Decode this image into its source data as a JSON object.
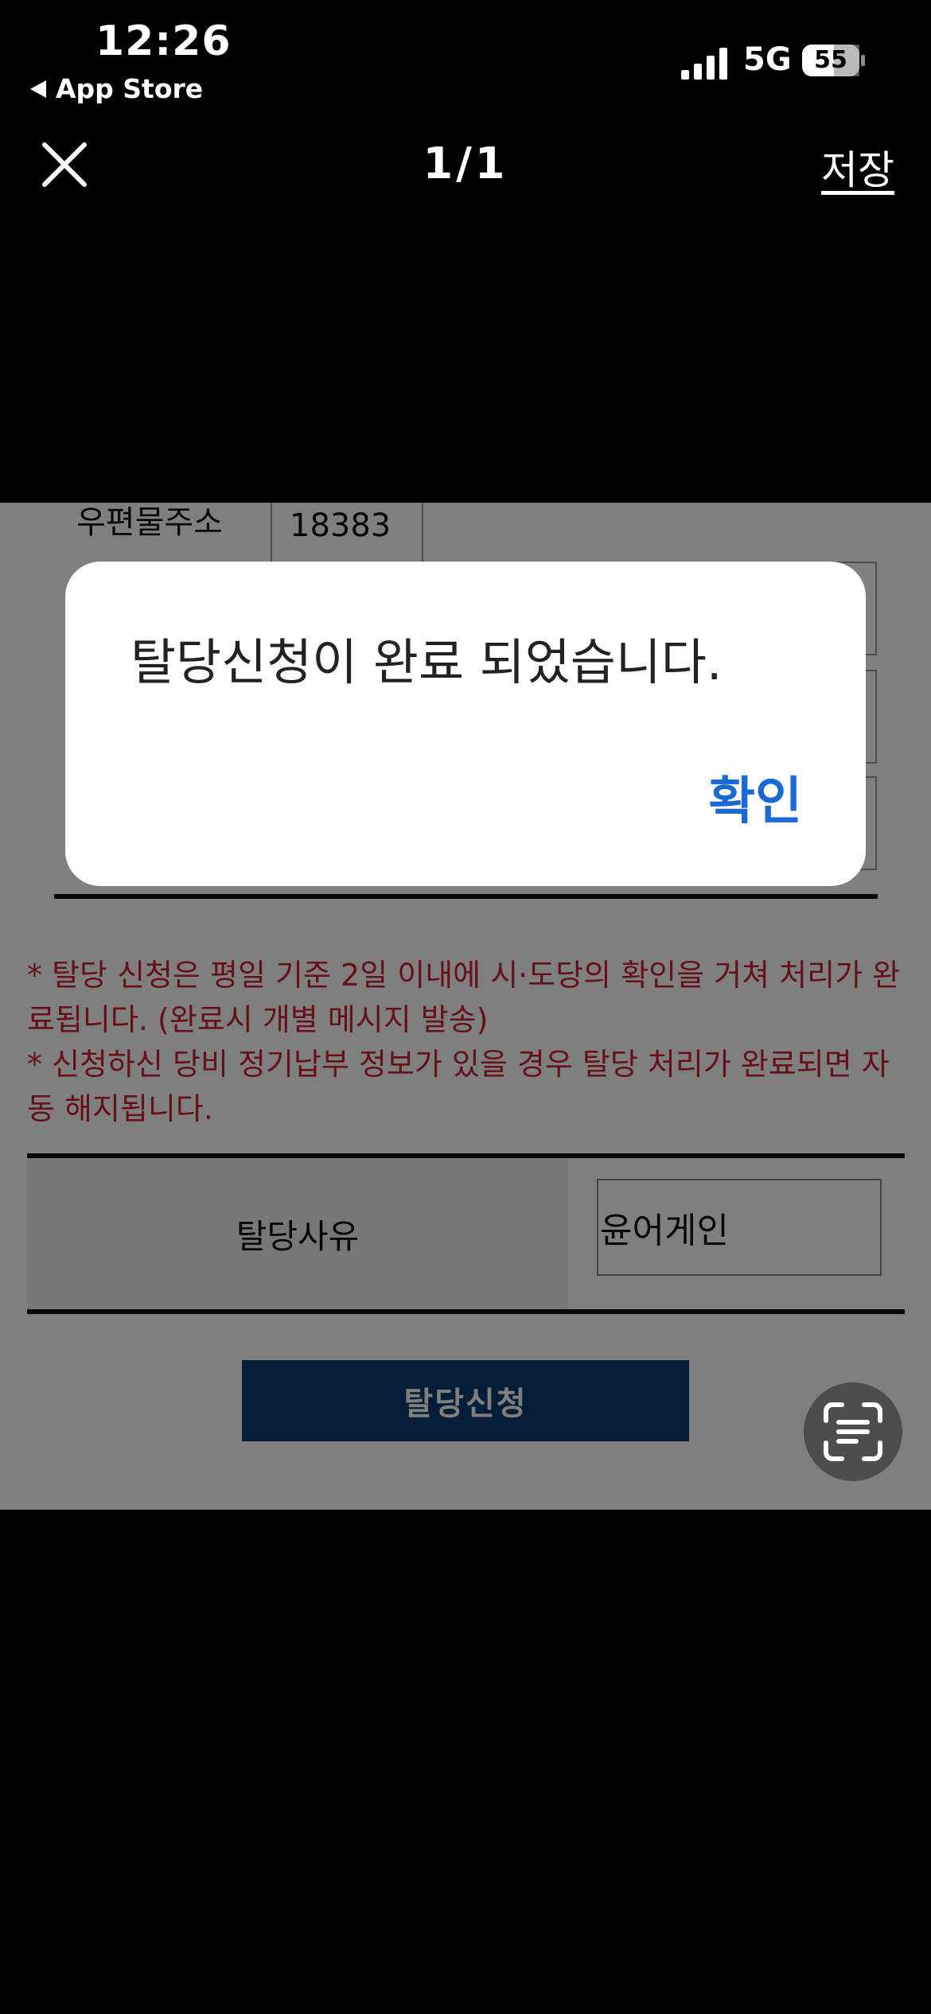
{
  "status_bar": {
    "time": "12:26",
    "back_app": "App Store",
    "network": "5G",
    "battery": "55"
  },
  "viewer": {
    "counter": "1/1",
    "save_label": "저장"
  },
  "form": {
    "postal_label": "우편물주소",
    "postal_value": "18383",
    "notes": [
      "* 탈당 신청은 평일 기준 2일 이내에 시·도당의 확인을 거쳐 처리가 완료됩니다. (완료시 개별 메시지 발송)",
      "* 신청하신 당비 정기납부 정보가 있을 경우 탈당 처리가 완료되면 자동 해지됩니다."
    ],
    "reason_label": "탈당사유",
    "reason_value": "윤어게인",
    "submit_label": "탈당신청"
  },
  "dialog": {
    "message": "탈당신청이 완료 되었습니다.",
    "confirm_label": "확인"
  },
  "colors": {
    "accent_blue": "#1a6ad6",
    "notice_red": "#cc2233",
    "submit_navy": "#0b3a6e"
  },
  "icons": [
    "signal-icon",
    "battery-icon",
    "close-icon",
    "live-text-scan-icon",
    "back-triangle-icon"
  ]
}
